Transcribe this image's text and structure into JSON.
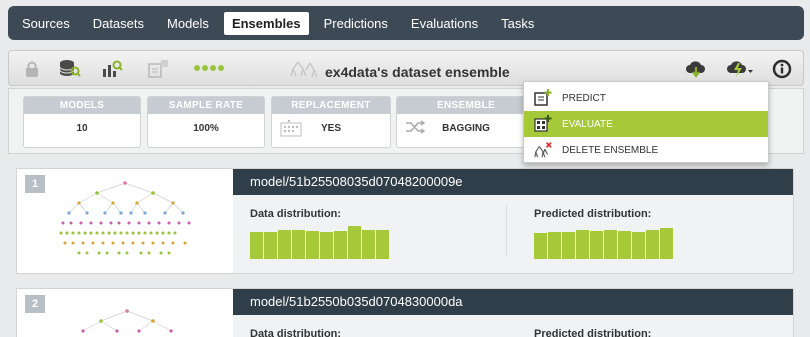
{
  "nav": {
    "items": [
      {
        "label": "Sources"
      },
      {
        "label": "Datasets"
      },
      {
        "label": "Models"
      },
      {
        "label": "Ensembles"
      },
      {
        "label": "Predictions"
      },
      {
        "label": "Evaluations"
      },
      {
        "label": "Tasks"
      }
    ],
    "active": "Ensembles"
  },
  "toolbar": {
    "title": "ex4data's dataset ensemble",
    "icons": [
      "lock-icon",
      "dataset-search-icon",
      "chart-search-icon",
      "predict-disabled-icon",
      "progress-dots-icon",
      "ensemble-icon",
      "download-icon",
      "actions-menu-icon",
      "info-icon"
    ]
  },
  "stats": [
    {
      "header": "MODELS",
      "value": "10"
    },
    {
      "header": "SAMPLE RATE",
      "value": "100%"
    },
    {
      "header": "REPLACEMENT",
      "value": "YES"
    },
    {
      "header": "ENSEMBLE",
      "value": "BAGGING"
    }
  ],
  "dropdown": {
    "items": [
      {
        "label": "PREDICT",
        "icon": "predict-icon"
      },
      {
        "label": "EVALUATE",
        "icon": "evaluate-icon"
      },
      {
        "label": "DELETE ENSEMBLE",
        "icon": "delete-ensemble-icon"
      }
    ],
    "selected": "EVALUATE"
  },
  "models": [
    {
      "number": "1",
      "id": "model/51b25508035d07048200009e",
      "data_label": "Data distribution:",
      "pred_label": "Predicted distribution:",
      "data_bars": [
        27,
        27,
        29,
        29,
        28,
        27,
        28,
        33,
        29,
        29
      ],
      "pred_bars": [
        26,
        27,
        27,
        29,
        28,
        29,
        28,
        27,
        29,
        31
      ]
    },
    {
      "number": "2",
      "id": "model/51b2550b035d0704830000da",
      "data_label": "Data distribution:",
      "pred_label": "Predicted distribution:",
      "data_bars": [],
      "pred_bars": []
    }
  ],
  "colors": {
    "nav_bg": "#3d4a55",
    "accent_green": "#a6c93a",
    "model_header": "#2f3e48"
  }
}
